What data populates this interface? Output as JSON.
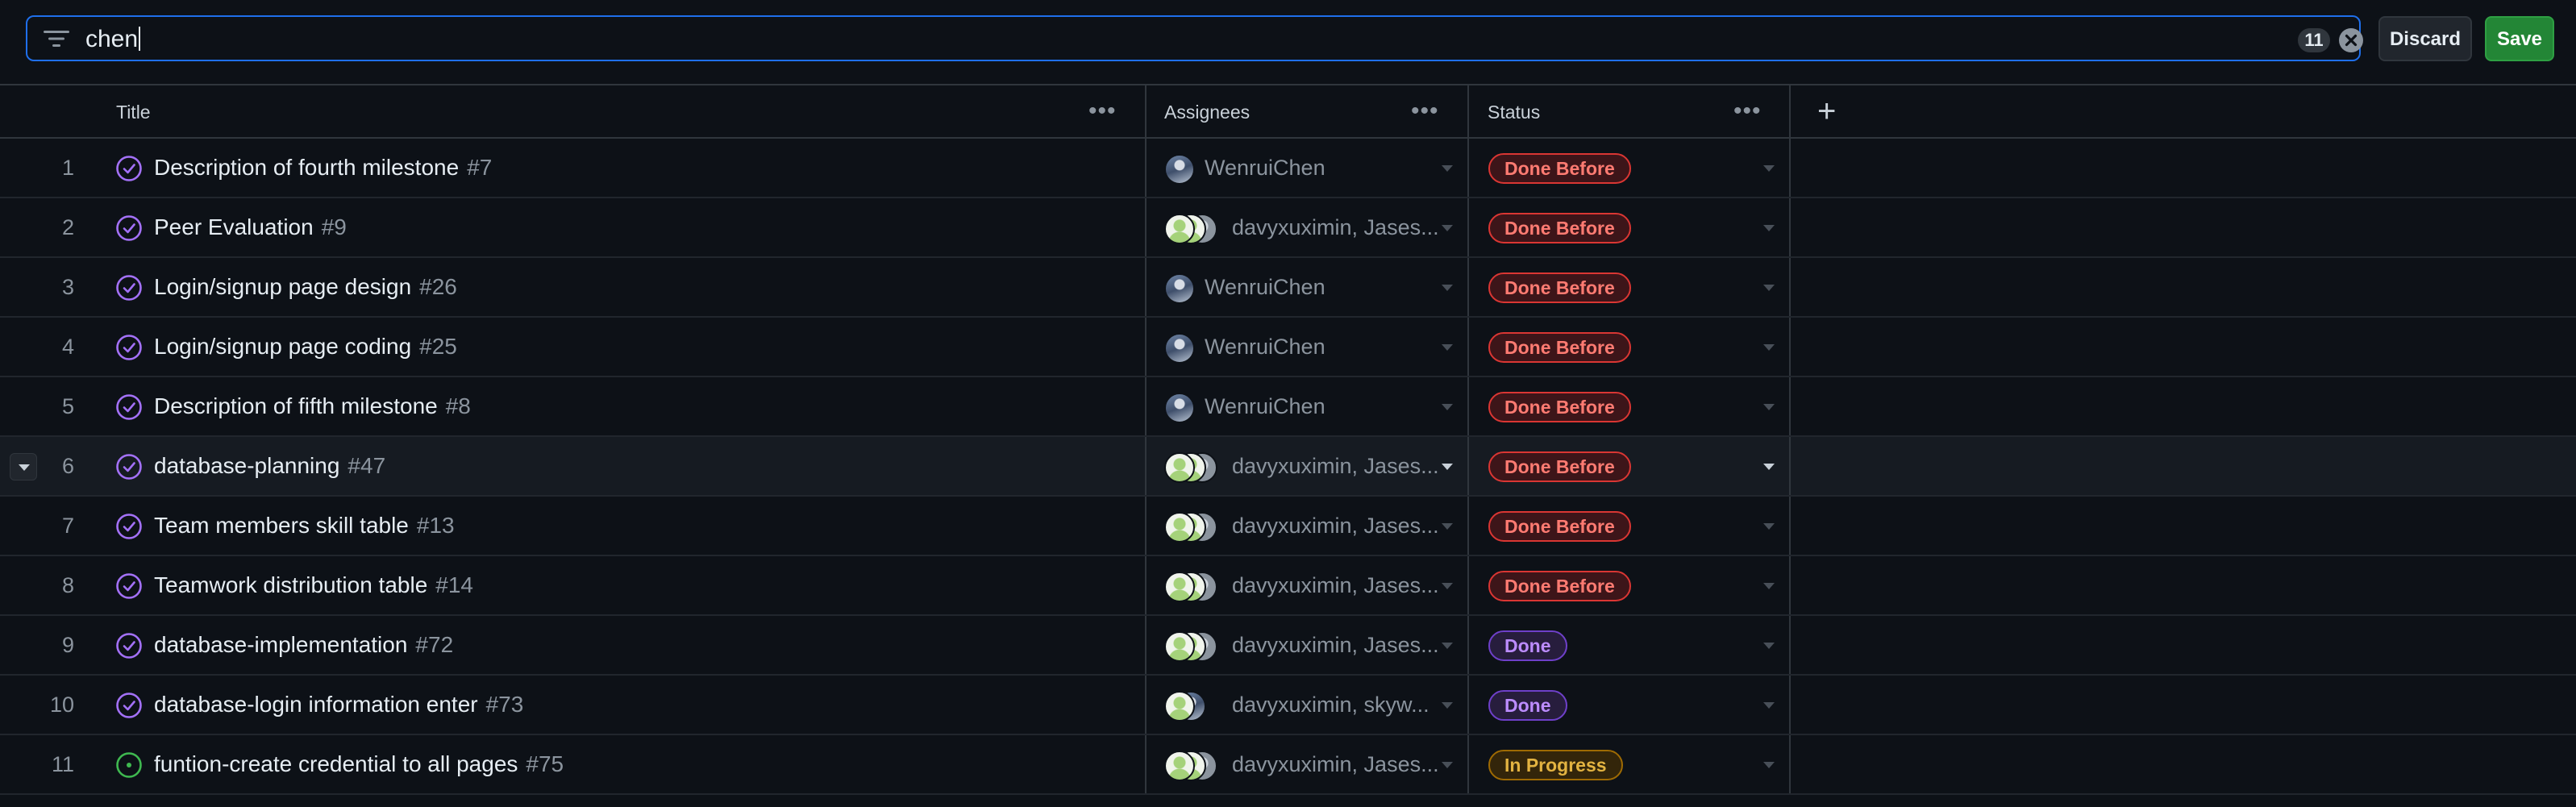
{
  "filter": {
    "query": "chen",
    "result_count": "11",
    "icon": "filter-lines-icon",
    "clear_icon": "x-circle-icon"
  },
  "actions": {
    "discard_label": "Discard",
    "save_label": "Save"
  },
  "columns": {
    "title": "Title",
    "assignees": "Assignees",
    "status": "Status",
    "add_icon": "plus-icon",
    "menu_icon": "ellipsis-icon"
  },
  "colors": {
    "accent_blue": "#1f6feb",
    "save_green": "#238636",
    "done_before_red": "#da3633",
    "done_purple": "#8957e5",
    "in_progress_yellow": "#d29922",
    "open_issue_green": "#3fb950"
  },
  "rows": [
    {
      "num": "1",
      "title": "Description of fourth milestone",
      "issue": "#7",
      "state": "closed",
      "assignees": "WenruiChen",
      "avatars": [
        "photo"
      ],
      "status": "Done Before",
      "status_color": "red"
    },
    {
      "num": "2",
      "title": "Peer Evaluation",
      "issue": "#9",
      "state": "closed",
      "assignees": "davyxuximin, Jases...",
      "avatars": [
        "green",
        "green",
        "grey"
      ],
      "status": "Done Before",
      "status_color": "red"
    },
    {
      "num": "3",
      "title": "Login/signup page design",
      "issue": "#26",
      "state": "closed",
      "assignees": "WenruiChen",
      "avatars": [
        "photo"
      ],
      "status": "Done Before",
      "status_color": "red"
    },
    {
      "num": "4",
      "title": "Login/signup page coding",
      "issue": "#25",
      "state": "closed",
      "assignees": "WenruiChen",
      "avatars": [
        "photo"
      ],
      "status": "Done Before",
      "status_color": "red"
    },
    {
      "num": "5",
      "title": "Description of fifth milestone",
      "issue": "#8",
      "state": "closed",
      "assignees": "WenruiChen",
      "avatars": [
        "photo"
      ],
      "status": "Done Before",
      "status_color": "red"
    },
    {
      "num": "6",
      "title": "database-planning",
      "issue": "#47",
      "state": "closed",
      "assignees": "davyxuximin, Jases...",
      "avatars": [
        "green",
        "green",
        "grey"
      ],
      "status": "Done Before",
      "status_color": "red",
      "hovered": true
    },
    {
      "num": "7",
      "title": "Team members skill table",
      "issue": "#13",
      "state": "closed",
      "assignees": "davyxuximin, Jases...",
      "avatars": [
        "green",
        "green",
        "grey"
      ],
      "status": "Done Before",
      "status_color": "red"
    },
    {
      "num": "8",
      "title": "Teamwork distribution table",
      "issue": "#14",
      "state": "closed",
      "assignees": "davyxuximin, Jases...",
      "avatars": [
        "green",
        "green",
        "grey"
      ],
      "status": "Done Before",
      "status_color": "red"
    },
    {
      "num": "9",
      "title": "database-implementation",
      "issue": "#72",
      "state": "closed",
      "assignees": "davyxuximin, Jases...",
      "avatars": [
        "green",
        "green",
        "grey"
      ],
      "status": "Done",
      "status_color": "purple"
    },
    {
      "num": "10",
      "title": "database-login information enter",
      "issue": "#73",
      "state": "closed",
      "assignees": "davyxuximin, skyw...",
      "avatars": [
        "green",
        "photo"
      ],
      "status": "Done",
      "status_color": "purple"
    },
    {
      "num": "11",
      "title": "funtion-create credential to all pages",
      "issue": "#75",
      "state": "open",
      "assignees": "davyxuximin, Jases...",
      "avatars": [
        "green",
        "green",
        "grey"
      ],
      "status": "In Progress",
      "status_color": "yellow"
    }
  ]
}
